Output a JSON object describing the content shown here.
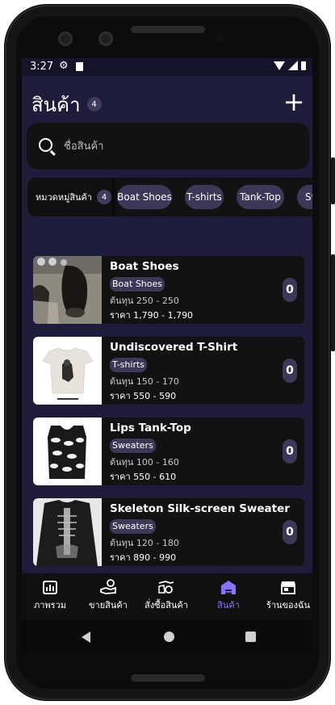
{
  "status": {
    "time": "3:27"
  },
  "header": {
    "title": "สินค้า",
    "count": "4"
  },
  "search": {
    "placeholder": "ชื่อสินค้า"
  },
  "categories": {
    "label": "หมวดหมู่สินค้า",
    "count": "4",
    "chips": [
      "Boat Shoes",
      "T-shirts",
      "Tank-Top",
      "Sw"
    ]
  },
  "products": [
    {
      "name": "Boat Shoes",
      "category": "Boat Shoes",
      "cost": "ต้นทุน 250 - 250",
      "price": "ราคา 1,790 - 1,790",
      "count": "0"
    },
    {
      "name": "Undiscovered T-Shirt",
      "category": "T-shirts",
      "cost": "ต้นทุน 150 - 170",
      "price": "ราคา 550 - 590",
      "count": "0"
    },
    {
      "name": "Lips Tank-Top",
      "category": "Sweaters",
      "cost": "ต้นทุน 100 - 160",
      "price": "ราคา 550 - 610",
      "count": "0"
    },
    {
      "name": "Skeleton Silk-screen Sweater",
      "category": "Sweaters",
      "cost": "ต้นทุน 120 - 180",
      "price": "ราคา 890 - 990",
      "count": "0"
    }
  ],
  "nav": {
    "items": [
      {
        "label": "ภาพรวม",
        "icon": "dashboard-icon"
      },
      {
        "label": "ขายสินค้า",
        "icon": "sell-icon"
      },
      {
        "label": "สั่งซื้อสินค้า",
        "icon": "purchase-icon"
      },
      {
        "label": "สินค้า",
        "icon": "products-icon",
        "active": true
      },
      {
        "label": "ร้านของฉัน",
        "icon": "store-icon"
      }
    ]
  },
  "colors": {
    "background": "#1e1c3a",
    "card": "#121212",
    "chip": "#3d3858",
    "accent": "#8a72ff"
  }
}
